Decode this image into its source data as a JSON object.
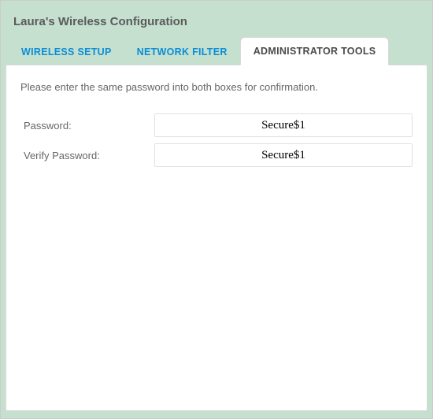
{
  "header": {
    "title": "Laura's Wireless Configuration"
  },
  "tabs": [
    {
      "label": "WIRELESS SETUP",
      "active": false
    },
    {
      "label": "NETWORK FILTER",
      "active": false
    },
    {
      "label": "ADMINISTRATOR TOOLS",
      "active": true
    }
  ],
  "form": {
    "instruction": "Please enter the same password into both boxes for confirmation.",
    "password_label": "Password:",
    "password_value": "Secure$1",
    "verify_label": "Verify Password:",
    "verify_value": "Secure$1"
  }
}
